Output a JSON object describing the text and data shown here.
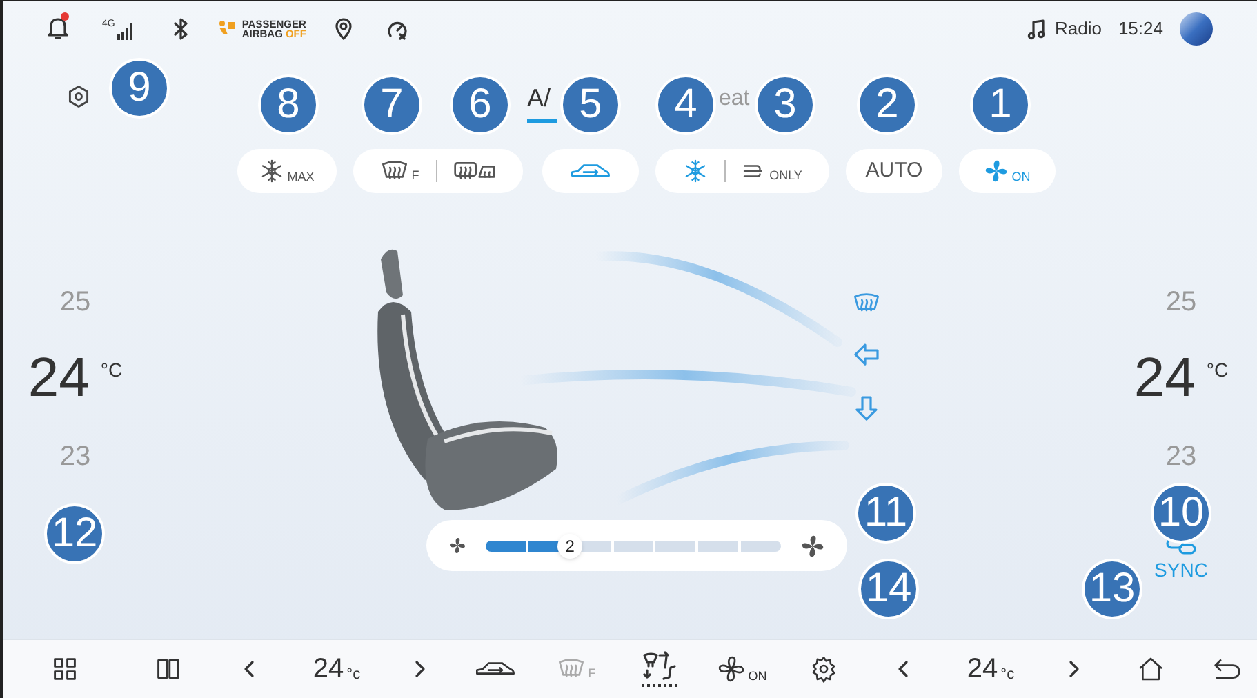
{
  "status_bar": {
    "network": "4G",
    "airbag": {
      "line1": "PASSENGER",
      "line2": "AIRBAG",
      "state": "OFF"
    },
    "notification_unread": true,
    "media": "Radio",
    "time": "15:24"
  },
  "tabs": [
    {
      "label": "A/",
      "selected": true
    },
    {
      "label": "eat",
      "selected": false
    }
  ],
  "controls": [
    {
      "segments": [
        {
          "kind": "snowflake",
          "label": "MAX",
          "on": false
        }
      ]
    },
    {
      "segments": [
        {
          "kind": "front-defrost",
          "label": "F",
          "on": false
        },
        {
          "kind": "rear-defrost",
          "on": false
        }
      ]
    },
    {
      "segments": [
        {
          "kind": "recirculation",
          "on": true
        }
      ]
    },
    {
      "segments": [
        {
          "kind": "snowflake",
          "on": true
        },
        {
          "kind": "vent",
          "label": "ONLY",
          "on": false
        }
      ]
    },
    {
      "segments": [
        {
          "kind": "text",
          "label": "AUTO",
          "on": false
        }
      ]
    },
    {
      "segments": [
        {
          "kind": "fan",
          "label": "ON",
          "on": true
        }
      ]
    }
  ],
  "left_zone": {
    "above": "25",
    "current": "24",
    "unit": "°C",
    "below": "23"
  },
  "right_zone": {
    "above": "25",
    "current": "24",
    "unit": "°C",
    "below": "23"
  },
  "air_directions": [
    {
      "kind": "defrost",
      "on": true
    },
    {
      "kind": "face",
      "on": true
    },
    {
      "kind": "feet",
      "on": true
    }
  ],
  "fan_speed": {
    "value": "2",
    "level": 0.2857
  },
  "sync": {
    "label": "SYNC",
    "on": true
  },
  "callouts": [
    "9",
    "8",
    "7",
    "6",
    "5",
    "4",
    "3",
    "2",
    "1",
    "12",
    "11",
    "10",
    "14",
    "13"
  ],
  "bottom_bar": [
    {
      "kind": "apps",
      "selected": false
    },
    {
      "kind": "split",
      "selected": false
    },
    {
      "kind": "prev",
      "selected": false
    },
    {
      "kind": "temp",
      "value": "24",
      "unit": "°c",
      "selected": false
    },
    {
      "kind": "next",
      "selected": false
    },
    {
      "kind": "recirculation",
      "selected": false
    },
    {
      "kind": "front-defrost",
      "label": "F",
      "selected": false
    },
    {
      "kind": "seat-airflow",
      "selected": true
    },
    {
      "kind": "fan",
      "label": "ON",
      "selected": false
    },
    {
      "kind": "settings",
      "selected": false
    },
    {
      "kind": "prev",
      "selected": false
    },
    {
      "kind": "temp",
      "value": "24",
      "unit": "°c",
      "selected": false
    },
    {
      "kind": "next",
      "selected": false
    },
    {
      "kind": "home",
      "selected": false
    },
    {
      "kind": "back",
      "selected": false
    }
  ]
}
